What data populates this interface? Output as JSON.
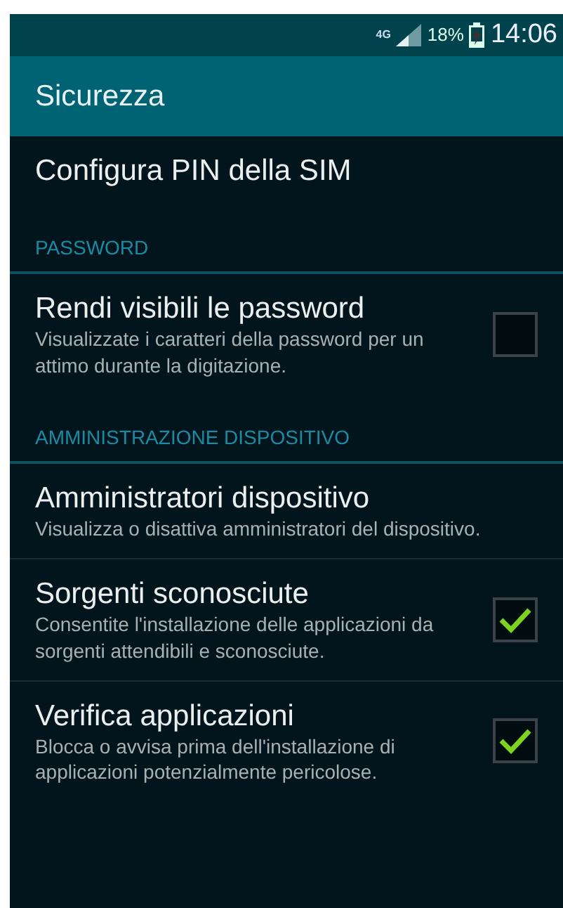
{
  "status_bar": {
    "network": "4G",
    "battery": "18%",
    "time": "14:06"
  },
  "title": "Sicurezza",
  "items": [
    {
      "kind": "plain",
      "title": "Configura PIN della SIM"
    },
    {
      "kind": "header",
      "title": "PASSWORD"
    },
    {
      "kind": "checkbox",
      "title": "Rendi visibili le password",
      "summary": "Visualizzate i caratteri della password per un attimo durante la digitazione.",
      "checked": false
    },
    {
      "kind": "header",
      "title": "AMMINISTRAZIONE DISPOSITIVO"
    },
    {
      "kind": "plain",
      "title": "Amministratori dispositivo",
      "summary": "Visualizza o disattiva amministratori del dispositivo."
    },
    {
      "kind": "checkbox",
      "title": "Sorgenti sconosciute",
      "summary": "Consentite l'installazione delle applicazioni da sorgenti attendibili e sconosciute.",
      "checked": true
    },
    {
      "kind": "checkbox",
      "title": "Verifica applicazioni",
      "summary": "Blocca o avvisa prima dell'installazione di applicazioni potenzialmente pericolose.",
      "checked": true
    }
  ]
}
